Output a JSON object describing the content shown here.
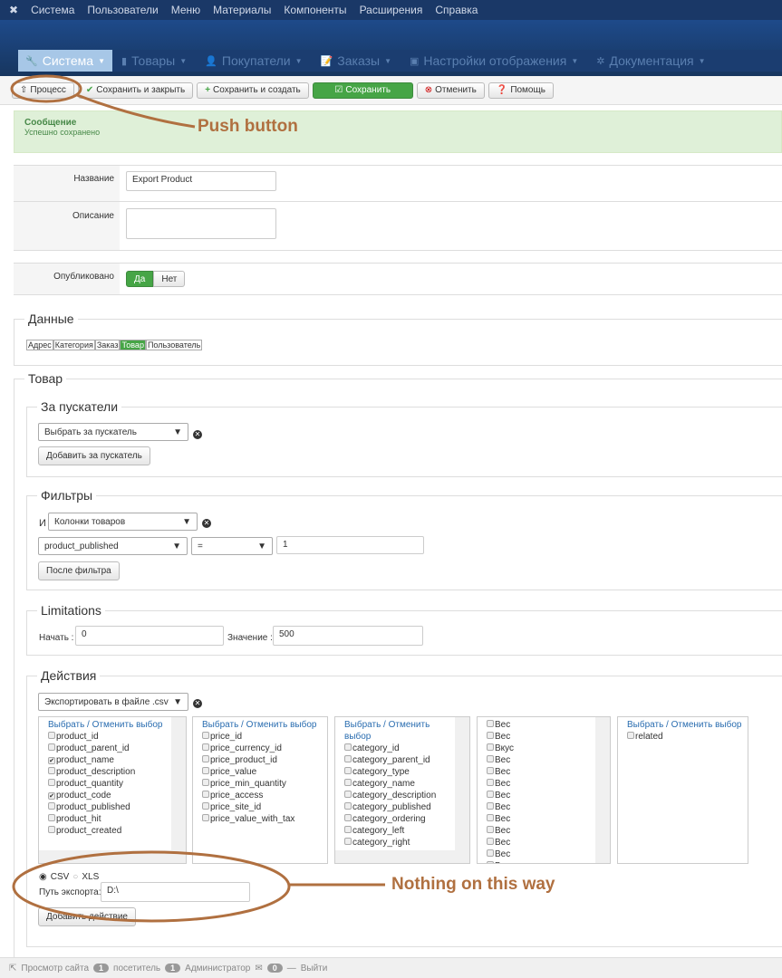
{
  "topmenu": [
    "Система",
    "Пользователи",
    "Меню",
    "Материалы",
    "Компоненты",
    "Расширения",
    "Справка"
  ],
  "subnav": [
    "Система",
    "Товары",
    "Покупатели",
    "Заказы",
    "Настройки отображения",
    "Документация"
  ],
  "toolbar": {
    "process": "Процесс",
    "save_close": "Сохранить и закрыть",
    "save_new": "Сохранить и создать",
    "save": "Сохранить",
    "cancel": "Отменить",
    "help": "Помощь"
  },
  "message": {
    "title": "Сообщение",
    "text": "Успешно сохранено"
  },
  "form": {
    "name_label": "Название",
    "name_value": "Export Product",
    "desc_label": "Описание",
    "published_label": "Опубликовано",
    "yes": "Да",
    "no": "Нет"
  },
  "data_section": {
    "legend": "Данные",
    "tabs": [
      "Адрес",
      "Категория",
      "Заказ",
      "Товар",
      "Пользователь"
    ]
  },
  "product_section": {
    "legend": "Товар"
  },
  "triggers": {
    "legend": "За пускатели",
    "select": "Выбрать за пускатель",
    "add": "Добавить за пускатель"
  },
  "filters": {
    "legend": "Фильтры",
    "and": "И",
    "columns": "Колонки товаров",
    "field": "product_published",
    "op": "=",
    "value": "1",
    "after": "После фильтра"
  },
  "limits": {
    "legend": "Limitations",
    "start_label": "Начать :",
    "start": "0",
    "value_label": "Значение :",
    "value": "500"
  },
  "actions": {
    "legend": "Действия",
    "export": "Экспортировать в файле .csv",
    "select_link": "Выбрать / Отменить выбор",
    "lists": [
      [
        {
          "t": "product_id",
          "c": false
        },
        {
          "t": "product_parent_id",
          "c": false
        },
        {
          "t": "product_name",
          "c": true
        },
        {
          "t": "product_description",
          "c": false
        },
        {
          "t": "product_quantity",
          "c": false
        },
        {
          "t": "product_code",
          "c": true
        },
        {
          "t": "product_published",
          "c": false
        },
        {
          "t": "product_hit",
          "c": false
        },
        {
          "t": "product_created",
          "c": false
        }
      ],
      [
        {
          "t": "price_id",
          "c": false
        },
        {
          "t": "price_currency_id",
          "c": false
        },
        {
          "t": "price_product_id",
          "c": false
        },
        {
          "t": "price_value",
          "c": false
        },
        {
          "t": "price_min_quantity",
          "c": false
        },
        {
          "t": "price_access",
          "c": false
        },
        {
          "t": "price_site_id",
          "c": false
        },
        {
          "t": "price_value_with_tax",
          "c": false
        }
      ],
      [
        {
          "t": "category_id",
          "c": false
        },
        {
          "t": "category_parent_id",
          "c": false
        },
        {
          "t": "category_type",
          "c": false
        },
        {
          "t": "category_name",
          "c": false
        },
        {
          "t": "category_description",
          "c": false
        },
        {
          "t": "category_published",
          "c": false
        },
        {
          "t": "category_ordering",
          "c": false
        },
        {
          "t": "category_left",
          "c": false
        },
        {
          "t": "category_right",
          "c": false
        }
      ],
      [
        {
          "t": "Вес",
          "c": false
        },
        {
          "t": "Вес",
          "c": false
        },
        {
          "t": "Вкус",
          "c": false
        },
        {
          "t": "Вес",
          "c": false
        },
        {
          "t": "Вес",
          "c": false
        },
        {
          "t": "Вес",
          "c": false
        },
        {
          "t": "Вес",
          "c": false
        },
        {
          "t": "Вес",
          "c": false
        },
        {
          "t": "Вес",
          "c": false
        },
        {
          "t": "Вес",
          "c": false
        },
        {
          "t": "Вес",
          "c": false
        },
        {
          "t": "Вес",
          "c": false
        },
        {
          "t": "Вес",
          "c": false
        }
      ],
      [
        {
          "t": "related",
          "c": false
        }
      ]
    ],
    "csv": "CSV",
    "xls": "XLS",
    "path_label": "Путь экспорта:",
    "path": "D:\\",
    "add": "Добавить действие"
  },
  "annotations": {
    "push": "Push button",
    "nothing": "Nothing on this way"
  },
  "footer": {
    "view_site": "Просмотр сайта",
    "visitors": "1",
    "visitors_label": "посетитель",
    "admins": "1",
    "admins_label": "Администратор",
    "messages": "0",
    "logout": "Выйти"
  }
}
